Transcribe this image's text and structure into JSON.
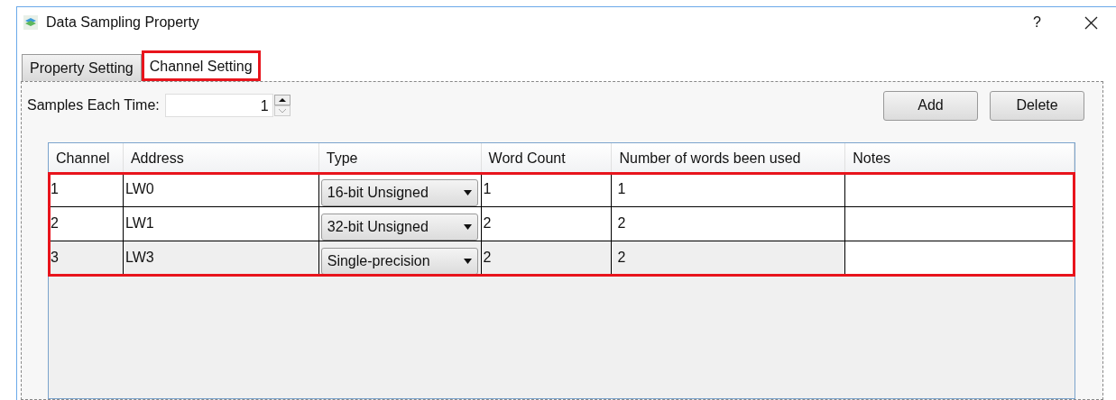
{
  "window": {
    "title": "Data Sampling Property",
    "help": "?"
  },
  "tabs": [
    {
      "label": "Property Setting",
      "selected": false,
      "highlighted": false
    },
    {
      "label": "Channel Setting",
      "selected": true,
      "highlighted": true
    }
  ],
  "samples_each_time": {
    "label": "Samples Each Time:",
    "value": "1"
  },
  "buttons": [
    "Add",
    "Delete"
  ],
  "table": {
    "columns": [
      "Channel",
      "Address",
      "Type",
      "Word Count",
      "Number of words been used",
      "Notes"
    ],
    "rows_highlighted": true,
    "rows": [
      {
        "channel": "1",
        "address": "LW0",
        "type": "16-bit Unsigned",
        "word_count": "1",
        "words_used": "1",
        "notes": "",
        "selected": false
      },
      {
        "channel": "2",
        "address": "LW1",
        "type": "32-bit Unsigned",
        "word_count": "2",
        "words_used": "2",
        "notes": "",
        "selected": false
      },
      {
        "channel": "3",
        "address": "LW3",
        "type": "Single-precision",
        "word_count": "2",
        "words_used": "2",
        "notes": "",
        "selected": true
      }
    ]
  }
}
